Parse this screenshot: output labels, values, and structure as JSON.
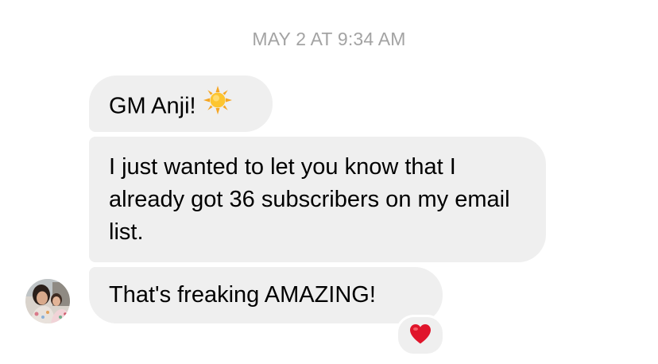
{
  "thread": {
    "timestamp": "MAY 2 AT 9:34 AM",
    "messages": [
      {
        "text": "GM Anji!",
        "emoji": "sun-emoji"
      },
      {
        "text": "I just wanted to let you know that I already got 36 subscribers on my email list."
      },
      {
        "text": "That's freaking AMAZING!",
        "reaction": "red-heart-emoji"
      }
    ]
  },
  "colors": {
    "bubble": "#efefef",
    "timestamp": "#a3a3a3",
    "text": "#000000",
    "heart": "#e0152b",
    "sun": "#fdc52f"
  }
}
